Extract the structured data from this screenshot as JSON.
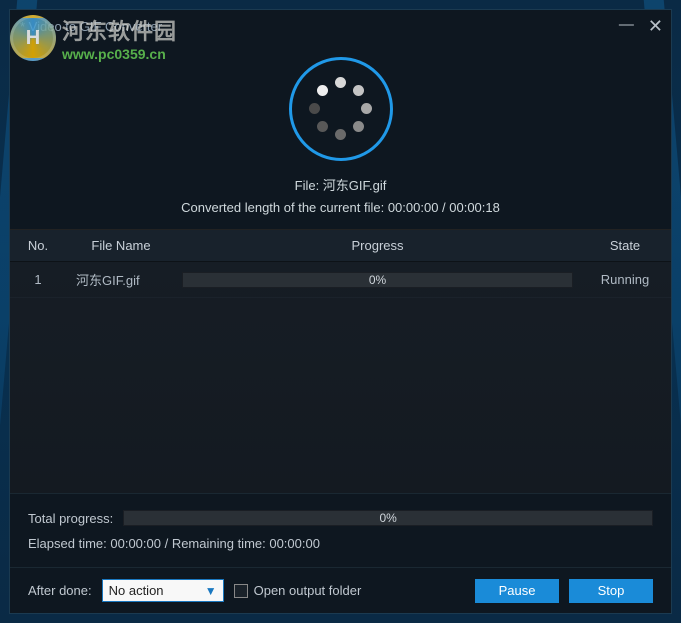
{
  "window": {
    "title": "* Video to GIF Converter"
  },
  "watermark": {
    "logo_text": "H",
    "cn": "河东软件园",
    "url": "www.pc0359.cn"
  },
  "top": {
    "file_label": "File: 河东GIF.gif",
    "converted_line": "Converted length of the current file: 00:00:00 / 00:00:18"
  },
  "table": {
    "headers": {
      "no": "No.",
      "name": "File Name",
      "progress": "Progress",
      "state": "State"
    },
    "rows": [
      {
        "no": "1",
        "name": "河东GIF.gif",
        "progress_text": "0%",
        "progress_pct": 0,
        "state": "Running"
      }
    ]
  },
  "bottom": {
    "total_label": "Total progress:",
    "total_text": "0%",
    "time_line": "Elapsed time: 00:00:00 / Remaining time: 00:00:00"
  },
  "footer": {
    "after_done_label": "After done:",
    "after_done_value": "No action",
    "open_folder_label": "Open output folder",
    "pause": "Pause",
    "stop": "Stop"
  }
}
